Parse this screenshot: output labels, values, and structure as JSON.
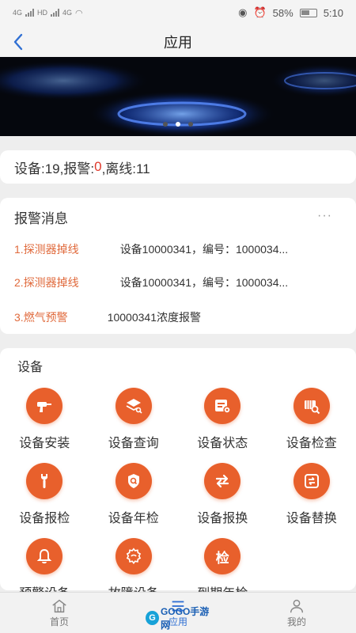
{
  "status_bar": {
    "left_tags": [
      "4G",
      "HD",
      "4G"
    ],
    "battery_percent": "58%",
    "time": "5:10"
  },
  "header": {
    "title": "应用",
    "back_icon": "chevron-left-icon"
  },
  "banner": {
    "slides_count": 3,
    "active_slide": 2
  },
  "summary": {
    "prefix": "设备:19,报警:",
    "alarm_count": "0",
    "suffix": ",离线:11"
  },
  "alarm_section": {
    "title": "报警消息",
    "more_label": "···",
    "items": [
      {
        "index": "1.",
        "type": "探测器掉线",
        "desc": "设备10000341，编号：1000034..."
      },
      {
        "index": "2.",
        "type": "探测器掉线",
        "desc": "设备10000341，编号：1000034..."
      },
      {
        "index": "3.",
        "type": "燃气预警",
        "desc": "10000341浓度报警"
      }
    ]
  },
  "device_section": {
    "title": "设备",
    "accent_color": "#e8602c",
    "items": [
      {
        "label": "设备安装",
        "icon": "drill-icon"
      },
      {
        "label": "设备查询",
        "icon": "layers-search-icon"
      },
      {
        "label": "设备状态",
        "icon": "device-status-icon"
      },
      {
        "label": "设备检查",
        "icon": "inspect-icon"
      },
      {
        "label": "设备报检",
        "icon": "wrench-icon"
      },
      {
        "label": "设备年检",
        "icon": "shield-search-icon"
      },
      {
        "label": "设备报换",
        "icon": "swap-arrows-icon"
      },
      {
        "label": "设备替换",
        "icon": "replace-icon"
      },
      {
        "label": "预警设备",
        "icon": "bell-icon"
      },
      {
        "label": "故障设备",
        "icon": "gear-icon"
      },
      {
        "label": "到期年检",
        "icon": "text-icon",
        "icon_text": "检"
      }
    ]
  },
  "tabbar": {
    "tabs": [
      {
        "label": "首页",
        "icon": "home-icon"
      },
      {
        "label": "应用",
        "icon": "menu-icon"
      },
      {
        "label": "我的",
        "icon": "user-icon"
      }
    ],
    "active_index": 1,
    "active_color": "#2f6fd3"
  },
  "watermark": {
    "text": "GOGO手游网"
  }
}
